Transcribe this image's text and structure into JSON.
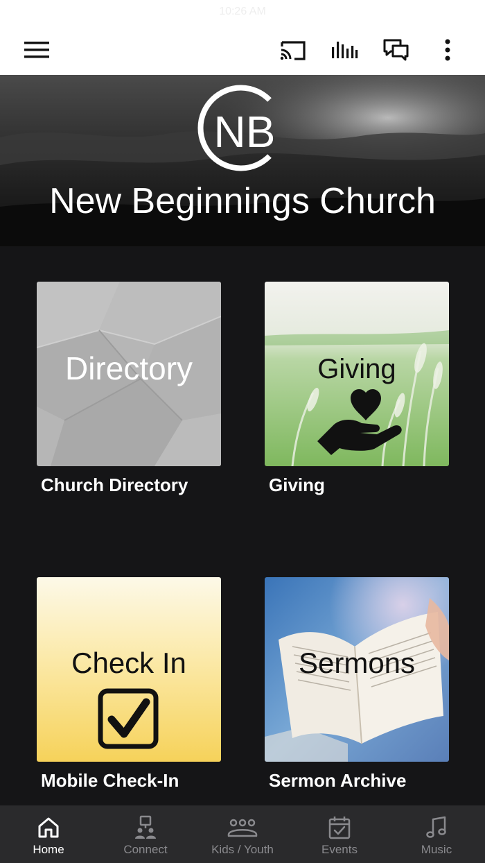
{
  "status_bar": {
    "time": "10:26 AM"
  },
  "app_bar": {
    "icons": [
      "menu-icon",
      "cast-icon",
      "audio-bars-icon",
      "chat-icon",
      "more-vert-icon"
    ]
  },
  "hero": {
    "logo_text": "NB",
    "church_name": "New Beginnings Church"
  },
  "tiles": [
    {
      "overlay": "Directory",
      "caption": "Church Directory"
    },
    {
      "overlay": "Giving",
      "caption": "Giving"
    },
    {
      "overlay": "Check In",
      "caption": "Mobile Check-In"
    },
    {
      "overlay": "Sermons",
      "caption": "Sermon Archive"
    }
  ],
  "bottom_nav": {
    "items": [
      {
        "label": "Home",
        "icon": "home-icon",
        "active": true
      },
      {
        "label": "Connect",
        "icon": "connect-icon",
        "active": false
      },
      {
        "label": "Kids / Youth",
        "icon": "group-icon",
        "active": false
      },
      {
        "label": "Events",
        "icon": "calendar-check-icon",
        "active": false
      },
      {
        "label": "Music",
        "icon": "music-note-icon",
        "active": false
      }
    ]
  },
  "colors": {
    "background": "#151517",
    "nav_background": "#2a2a2c",
    "nav_inactive": "#8a8a8e",
    "nav_active": "#ffffff"
  }
}
